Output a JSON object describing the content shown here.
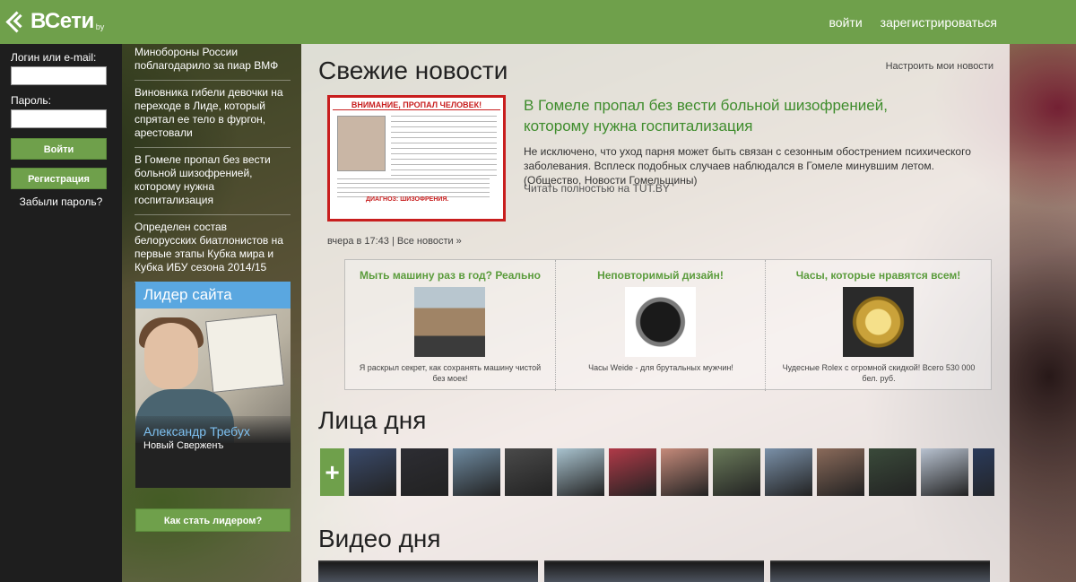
{
  "header": {
    "logo_text": "ВСети",
    "logo_sub": "by",
    "nav": [
      {
        "label": "войти"
      },
      {
        "label": "зарегистрироваться"
      }
    ]
  },
  "login": {
    "login_label": "Логин или e-mail:",
    "password_label": "Пароль:",
    "submit_label": "Войти",
    "register_label": "Регистрация",
    "forgot_label": "Забыли пароль?"
  },
  "sidebar_news": [
    {
      "text": "Минобороны России поблагодарило за пиар ВМФ"
    },
    {
      "text": "Виновника гибели девочки на переходе в Лиде, который спрятал ее тело в фургон, арестовали"
    },
    {
      "text": "В Гомеле пропал без вести больной шизофренией, которому нужна госпитализация"
    },
    {
      "text": "Определен состав белорусских биатлонистов на первые этапы Кубка мира и Кубка ИБУ сезона 2014/15"
    }
  ],
  "leader": {
    "heading": "Лидер сайта",
    "name": "Александр Требух",
    "status": "Новый Сверженъ",
    "how_label": "Как стать лидером?"
  },
  "main": {
    "news_heading": "Свежие новости",
    "configure_label": "Настроить мои новости",
    "poster_title": "ВНИМАНИЕ, ПРОПАЛ ЧЕЛОВЕК!",
    "poster_diagnosis": "ДИАГНОЗ: ШИЗОФРЕНИЯ.",
    "article_title": "В Гомеле пропал без вести больной шизофренией, которому нужна госпитализация",
    "article_body": "Не исключено, что уход парня может быть связан с сезонным обострением психического заболевания. Всплеск подобных случаев наблюдался в Гомеле минувшим летом. (Общество, Новости Гомельщины)",
    "article_more": "Читать полностью на TUT.BY",
    "article_time": "вчера в 17:43",
    "all_news": "Все новости »",
    "ads": [
      {
        "title": "Мыть машину раз в год? Реально",
        "text": "Я раскрыл секрет, как сохранять машину чистой без моек!",
        "image": "car-image"
      },
      {
        "title": "Неповторимый дизайн!",
        "text": "Часы Weide - для брутальных мужчин!",
        "image": "watch-image"
      },
      {
        "title": "Часы, которые нравятся всем!",
        "text": "Чудесные Rolex с огромной скидкой! Всего 530 000 бел. руб.",
        "image": "gold-watch-image"
      }
    ],
    "faces_heading": "Лица дня",
    "faces_add_label": "+",
    "faces_colors": [
      "#3a4a6a",
      "#2d2d33",
      "#6e8aa0",
      "#4a4a4a",
      "#a9c3cf",
      "#b03a48",
      "#c58a7a",
      "#6a7a5a",
      "#7a90a8",
      "#8a6a5a",
      "#3a4a3a",
      "#b8c2d0",
      "#2a3a5a",
      "#c07a80"
    ],
    "video_heading": "Видео дня"
  }
}
